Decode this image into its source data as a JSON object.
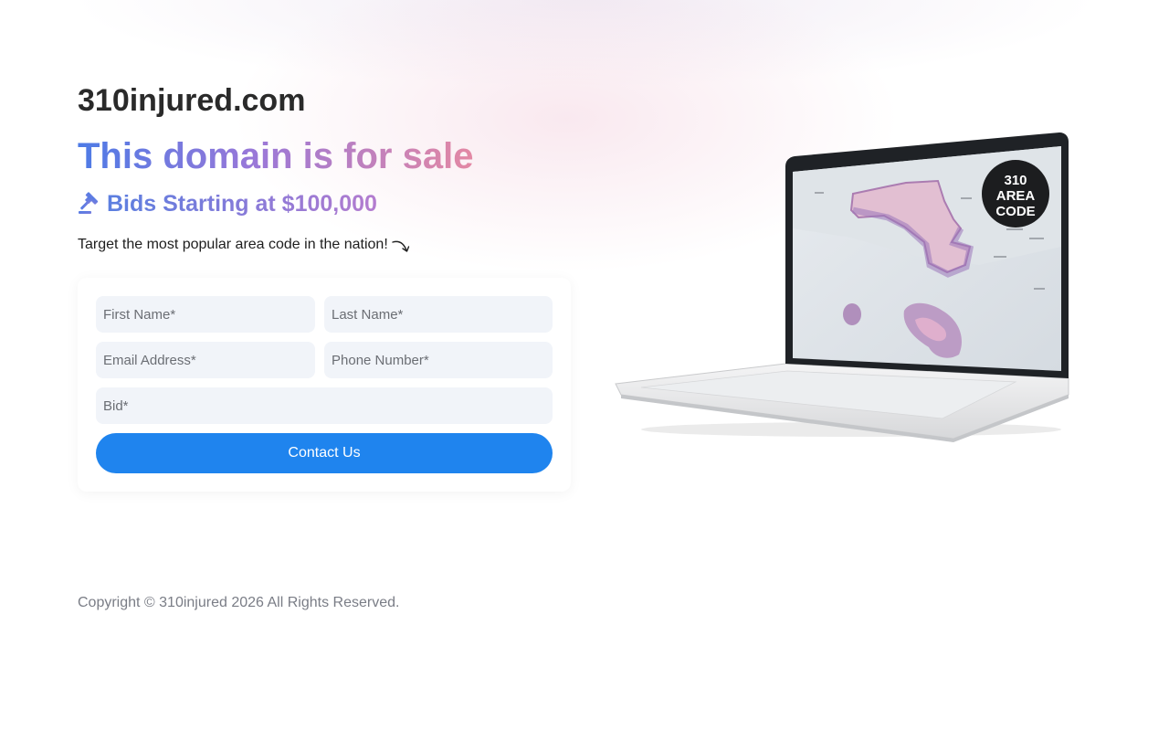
{
  "site": {
    "domain": "310injured.com",
    "headline": "This domain is for sale",
    "bids_text": "Bids Starting at $100,000",
    "tagline": "Target the most popular area code in the nation!"
  },
  "icons": {
    "gavel": "gavel-icon",
    "arrow": "curved-arrow-icon"
  },
  "form": {
    "first_name_placeholder": "First Name*",
    "last_name_placeholder": "Last Name*",
    "email_placeholder": "Email Address*",
    "phone_placeholder": "Phone Number*",
    "bid_placeholder": "Bid*",
    "submit_label": "Contact Us"
  },
  "hero_image": {
    "badge_line1": "310",
    "badge_line2": "AREA",
    "badge_line3": "CODE"
  },
  "footer": {
    "copyright": "Copyright © 310injured 2026 All Rights Reserved."
  },
  "colors": {
    "accent": "#1f84ee",
    "gradient_start": "#4d7be6",
    "gradient_end": "#e388a4",
    "field_bg": "#f1f4f9"
  }
}
